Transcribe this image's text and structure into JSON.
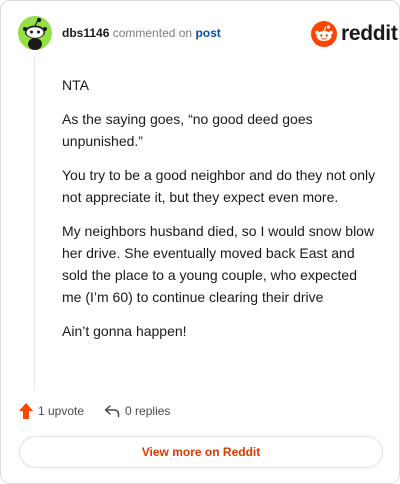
{
  "header": {
    "username": "dbs1146",
    "action_text": "commented on",
    "post_link": "post",
    "logo_text": "reddit"
  },
  "comment": {
    "paragraphs": [
      "NTA",
      "As the saying goes, “no good deed goes unpunished.”",
      "You try to be a good neighbor and do they not only not appreciate it, but they expect even more.",
      "My neighbors husband died, so I would snow blow her drive. She eventually moved back East and sold the place to a young couple, who expected me (I’m 60) to continue clearing their drive",
      "Ain’t gonna happen!"
    ]
  },
  "actions": {
    "upvotes": "1 upvote",
    "replies": "0 replies"
  },
  "footer": {
    "view_more": "View more on Reddit"
  },
  "colors": {
    "brand": "#ff4500",
    "link": "#0b4dab",
    "button_text": "#d93a00",
    "avatar_bg": "#94e044"
  },
  "icons": {
    "avatar": "snoo-avatar-icon",
    "logo": "reddit-logo-icon",
    "upvote": "upvote-arrow-icon",
    "reply": "reply-arrow-icon"
  }
}
